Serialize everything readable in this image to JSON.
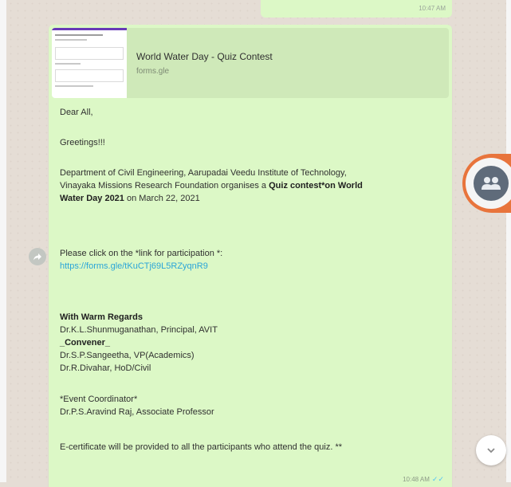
{
  "colors": {
    "chat_bg": "#e5ddd5",
    "bubble_out": "#dcf8c6",
    "link": "#2aa5d8",
    "fab_accent": "#e8743c"
  },
  "prev_message": {
    "time": "10:47 AM"
  },
  "link_preview": {
    "title": "World Water Day - Quiz Contest",
    "domain": "forms.gle"
  },
  "message": {
    "greeting": "Dear All,",
    "greetings": "Greetings!!!",
    "para1_line1": "Department of Civil Engineering, Aarupadai Veedu Institute of Technology,",
    "para1_line2a": "Vinayaka Missions Research Foundation organises a ",
    "para1_bold1": "Quiz contest*on World",
    "para1_bold2": "Water Day 2021",
    "para1_line3b": " on March 22, 2021",
    "click_text": "Please click on the *link for participation *:",
    "link": "https://forms.gle/tKuCTj69L5RZyqnR9",
    "regards": "With Warm Regards",
    "principal": "Dr.K.L.Shunmuganathan, Principal, AVIT",
    "convener": "_Convener_",
    "vp": "Dr.S.P.Sangeetha, VP(Academics)",
    "hod": "Dr.R.Divahar, HoD/Civil",
    "coordinator_label": "*Event Coordinator*",
    "coordinator": "Dr.P.S.Aravind Raj, Associate Professor",
    "certificate": "E-certificate will be provided to all the participants who attend the quiz. **",
    "time": "10:48 AM"
  },
  "icons": {
    "forward": "forward-icon",
    "people": "people-icon",
    "scroll_down": "chevron-down-icon"
  }
}
